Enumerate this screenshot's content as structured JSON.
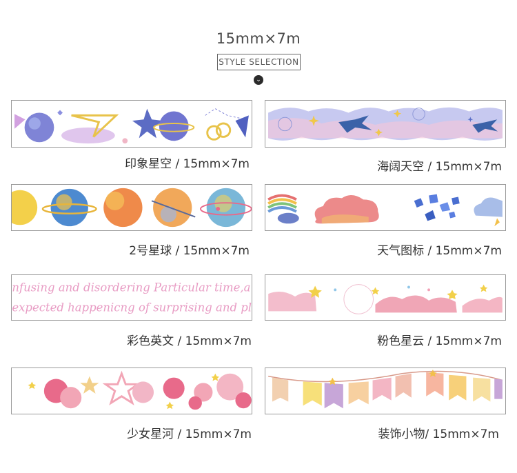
{
  "header": {
    "size_title": "15mm×7m",
    "style_label": "STYLE SELECTION",
    "down_icon": "chevron-down-icon"
  },
  "products": [
    {
      "caption": "印象星空 / 15mm×7m"
    },
    {
      "caption": "海阔天空 / 15mm×7m"
    },
    {
      "caption": "2号星球 / 15mm×7m"
    },
    {
      "caption": "天气图标 / 15mm×7m"
    },
    {
      "caption": "彩色英文 / 15mm×7m",
      "text_line_1": "nfusing and disordering Particular time,a particul",
      "text_line_2": "expected happenicng of surprising and pleasing fa"
    },
    {
      "caption": "粉色星云 / 15mm×7m"
    },
    {
      "caption": "少女星河 / 15mm×7m"
    },
    {
      "caption": "装饰小物/ 15mm×7m"
    }
  ]
}
